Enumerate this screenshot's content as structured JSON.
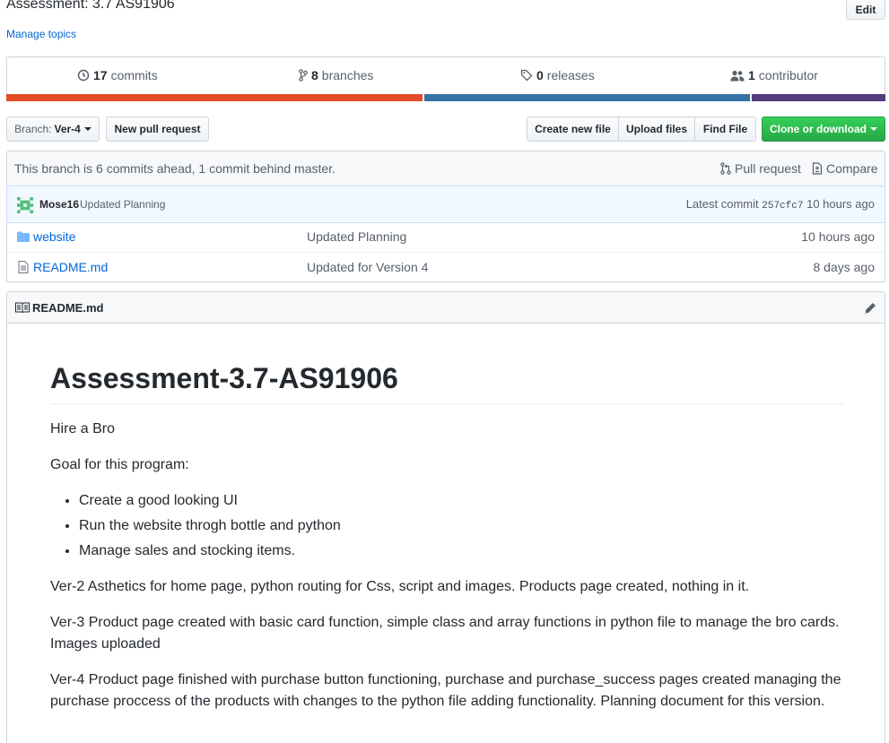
{
  "repo": {
    "description": "Assessment: 3.7 AS91906",
    "manage_topics": "Manage topics",
    "edit_label": "Edit"
  },
  "summary": {
    "commits_count": "17",
    "commits_label": "commits",
    "branches_count": "8",
    "branches_label": "branches",
    "releases_count": "0",
    "releases_label": "releases",
    "contributors_count": "1",
    "contributors_label": "contributor"
  },
  "language_bar": [
    {
      "color": "#e34c26",
      "share": 0.475
    },
    {
      "color": "#3572A5",
      "share": 0.372
    },
    {
      "color": "#563d7c",
      "share": 0.153
    }
  ],
  "toolbar": {
    "branch_prefix": "Branch:",
    "branch_name": "Ver-4",
    "new_pr": "New pull request",
    "create_file": "Create new file",
    "upload_files": "Upload files",
    "find_file": "Find File",
    "clone": "Clone or download"
  },
  "branch_status": {
    "text": "This branch is 6 commits ahead, 1 commit behind master.",
    "pull_request": "Pull request",
    "compare": "Compare"
  },
  "latest_commit": {
    "author": "Mose16",
    "message": "Updated Planning",
    "prefix": "Latest commit",
    "sha": "257cfc7",
    "age": "10 hours ago"
  },
  "files": [
    {
      "icon": "folder-icon",
      "name": "website",
      "message": "Updated Planning",
      "age": "10 hours ago"
    },
    {
      "icon": "file-icon",
      "name": "README.md",
      "message": "Updated for Version 4",
      "age": "8 days ago"
    }
  ],
  "readme": {
    "header": "README.md",
    "h1": "Assessment-3.7-AS91906",
    "p1": "Hire a Bro",
    "p2": "Goal for this program:",
    "list": [
      "Create a good looking UI",
      "Run the website throgh bottle and python",
      "Manage sales and stocking items."
    ],
    "p3": "Ver-2 Asthetics for home page, python routing for Css, script and images. Products page created, nothing in it.",
    "p4": "Ver-3 Product page created with basic card function, simple class and array functions in python file to manage the bro cards. Images uploaded",
    "p5": "Ver-4 Product page finished with purchase button functioning, purchase and purchase_success pages created managing the purchase proccess of the products with changes to the python file adding functionality. Planning document for this version."
  }
}
